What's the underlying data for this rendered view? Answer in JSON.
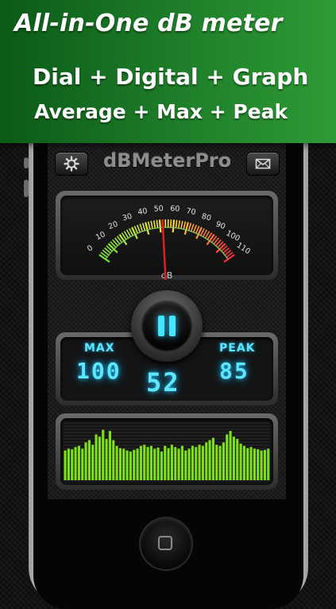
{
  "banner": {
    "headline": "All-in-One dB meter",
    "features_line1": "Dial + Digital + Graph",
    "features_line2": "Average + Max + Peak"
  },
  "app": {
    "title": "dBMeterPro",
    "settings_icon": "gear-icon",
    "share_icon": "envelope-icon"
  },
  "dial": {
    "scale_labels": [
      "0",
      "10",
      "20",
      "30",
      "40",
      "50",
      "60",
      "70",
      "80",
      "90",
      "100",
      "110"
    ],
    "unit": "dB",
    "needle_value": 52
  },
  "readout": {
    "max_label": "MAX",
    "max_value": "100",
    "current_value": "52",
    "peak_label": "PEAK",
    "peak_value": "85"
  },
  "graph": {
    "bar_levels": [
      0.52,
      0.55,
      0.54,
      0.58,
      0.6,
      0.55,
      0.66,
      0.7,
      0.62,
      0.8,
      0.76,
      0.88,
      0.72,
      0.86,
      0.7,
      0.6,
      0.56,
      0.55,
      0.52,
      0.5,
      0.53,
      0.55,
      0.6,
      0.62,
      0.58,
      0.6,
      0.55,
      0.57,
      0.5,
      0.6,
      0.56,
      0.62,
      0.58,
      0.55,
      0.6,
      0.52,
      0.55,
      0.6,
      0.58,
      0.62,
      0.6,
      0.66,
      0.7,
      0.74,
      0.62,
      0.6,
      0.66,
      0.8,
      0.86,
      0.76,
      0.72,
      0.64,
      0.6,
      0.56,
      0.58,
      0.55,
      0.54,
      0.52,
      0.53,
      0.55
    ],
    "bar_color": "#7de01a"
  },
  "colors": {
    "banner_green": "#1f7f2a",
    "digit_cyan": "#5ee6ff",
    "needle_red": "#e02020"
  }
}
